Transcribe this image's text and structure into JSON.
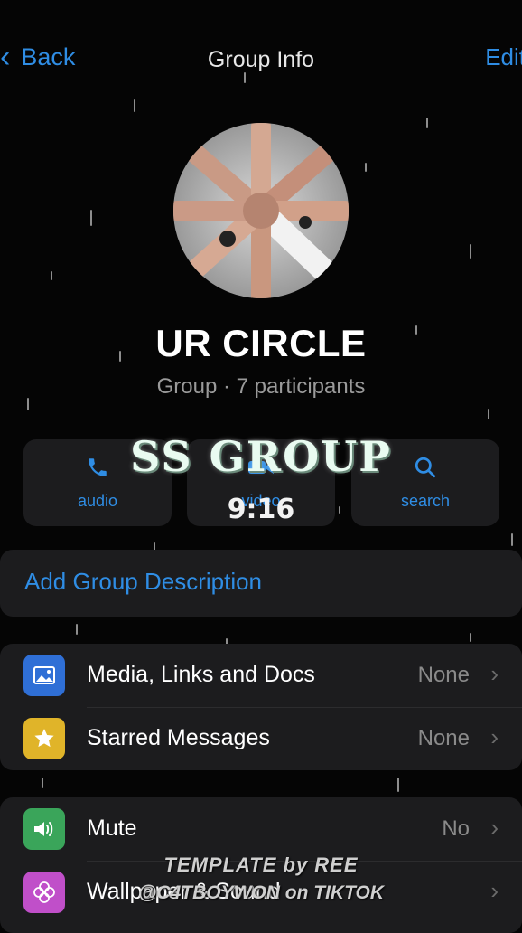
{
  "nav": {
    "back_label": "Back",
    "title": "Group Info",
    "edit_label": "Edit"
  },
  "group": {
    "name": "UR CIRCLE",
    "subtitle": "Group · 7 participants"
  },
  "actions": [
    {
      "label": "audio",
      "icon": "phone-icon"
    },
    {
      "label": "video",
      "icon": "video-icon"
    },
    {
      "label": "search",
      "icon": "search-icon"
    }
  ],
  "overlay": {
    "title": "SS GROUP",
    "time": "9:16"
  },
  "description": {
    "label": "Add Group Description"
  },
  "media_section": [
    {
      "label": "Media, Links and Docs",
      "value": "None",
      "icon": "photo-icon",
      "color": "#2f6fd6"
    },
    {
      "label": "Starred Messages",
      "value": "None",
      "icon": "star-icon",
      "color": "#e0b429"
    }
  ],
  "settings_section": [
    {
      "label": "Mute",
      "value": "No",
      "icon": "speaker-icon",
      "color": "#3aa55a"
    },
    {
      "label": "Wallpaper & Sound",
      "value": "",
      "icon": "flower-icon",
      "color": "#c04fc9"
    }
  ],
  "footer": {
    "line1": "TEMPLATE by REE",
    "line2": "@C4TBOYWON on TIKTOK"
  },
  "colors": {
    "accent": "#2f8de4",
    "background": "#050505",
    "card": "#1c1c1e"
  }
}
